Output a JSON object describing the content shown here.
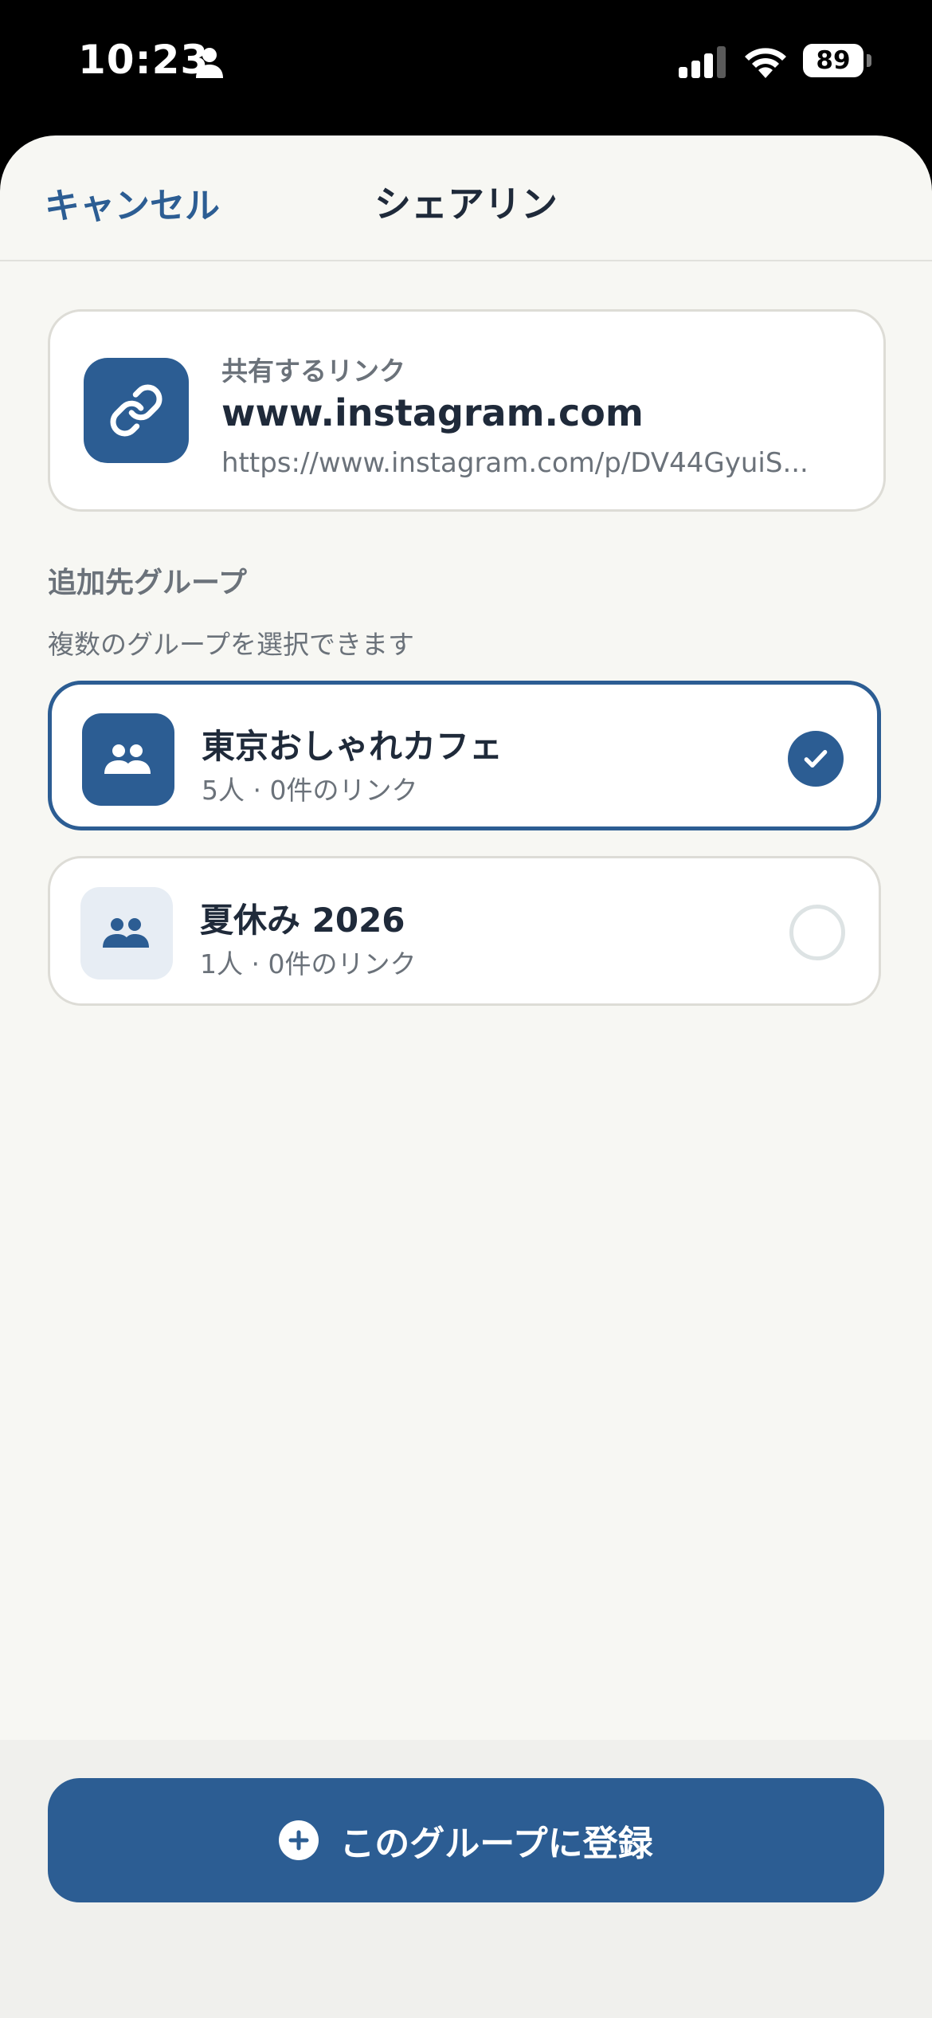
{
  "status_bar": {
    "time": "10:23",
    "battery": "89"
  },
  "nav": {
    "cancel_label": "キャンセル",
    "title": "シェアリン"
  },
  "link_card": {
    "caption": "共有するリンク",
    "domain": "www.instagram.com",
    "url": "https://www.instagram.com/p/DV44GyuiS..."
  },
  "groups_section": {
    "title": "追加先グループ",
    "subtitle": "複数のグループを選択できます",
    "groups": [
      {
        "name": "東京おしゃれカフェ",
        "meta": "5人 · 0件のリンク",
        "selected": true
      },
      {
        "name": "夏休み 2026",
        "meta": "1人 · 0件のリンク",
        "selected": false
      }
    ]
  },
  "footer": {
    "register_label": "このグループに登録"
  },
  "colors": {
    "accent": "#2c5d93",
    "background": "#f7f7f3",
    "text": "#1f2a3a",
    "muted": "#6b727a"
  }
}
